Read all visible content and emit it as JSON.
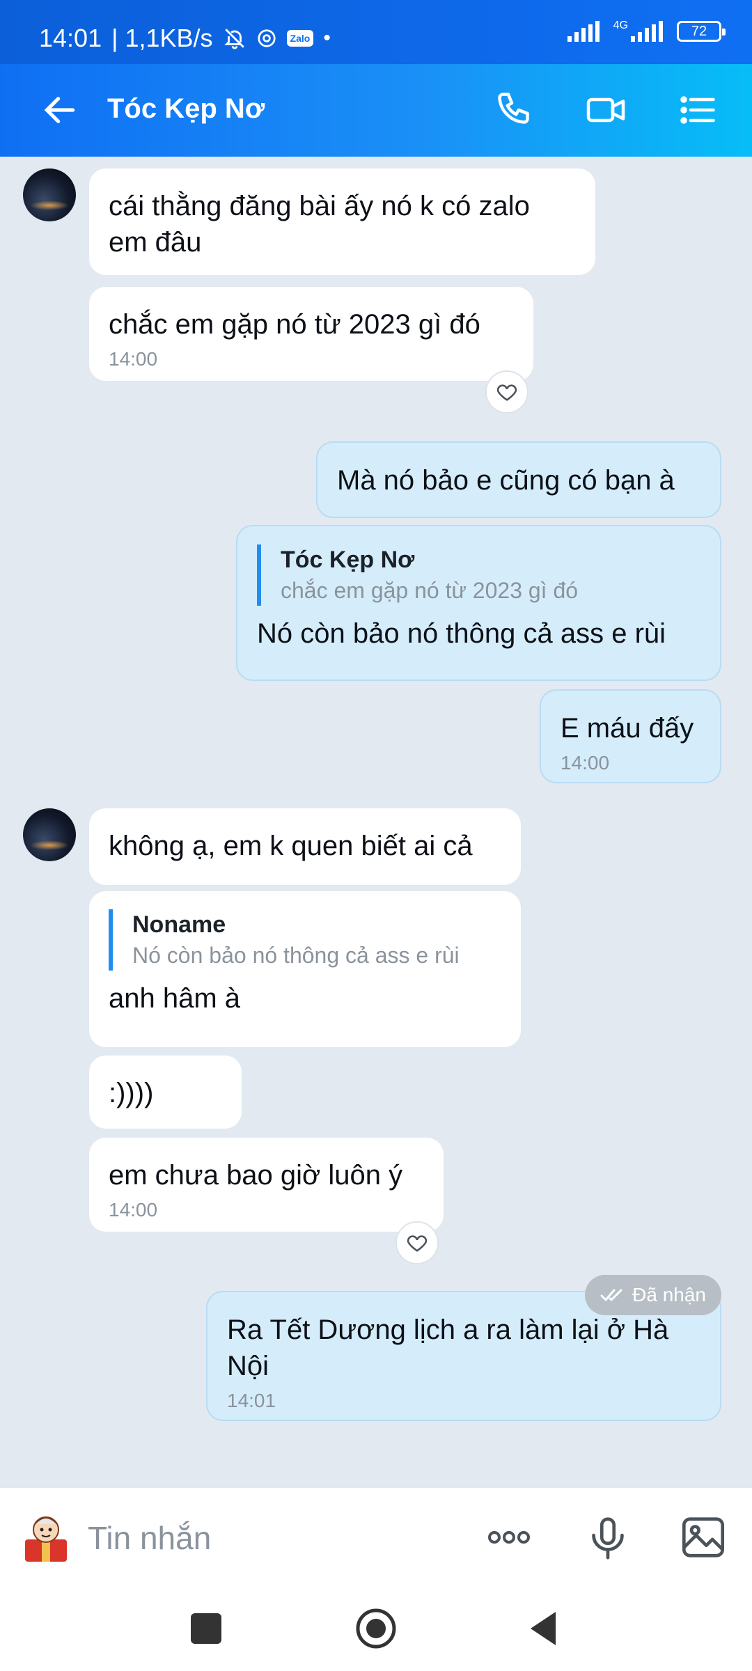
{
  "status_bar": {
    "time": "14:01",
    "speed": "| 1,1KB/s",
    "zalo_badge": "Zalo",
    "network": "4G",
    "battery": "72"
  },
  "header": {
    "title": "Tóc Kẹp Nơ"
  },
  "messages": {
    "m1": {
      "text": "cái thằng đăng bài ấy nó k có zalo em đâu"
    },
    "m2": {
      "text": "chắc em gặp nó từ 2023 gì đó",
      "time": "14:00"
    },
    "m3": {
      "text": "Mà nó bảo e cũng có bạn à"
    },
    "m4": {
      "quote_name": "Tóc Kẹp Nơ",
      "quote_text": "chắc em gặp nó từ 2023 gì đó",
      "text": "Nó còn bảo nó thông cả ass e rùi"
    },
    "m5": {
      "text": "E máu đấy",
      "time": "14:00"
    },
    "m6": {
      "text": "không ạ, em k quen biết ai cả"
    },
    "m7": {
      "quote_name": "Noname",
      "quote_text": "Nó còn bảo nó thông cả ass e rùi",
      "text": "anh hâm à"
    },
    "m8": {
      "text": ":))))"
    },
    "m9": {
      "text": "em chưa bao giờ luôn ý",
      "time": "14:00"
    },
    "m10": {
      "text": "Ra Tết Dương lịch a ra làm lại ở Hà Nội",
      "time": "14:01"
    }
  },
  "delivery_status": "Đã nhận",
  "input": {
    "placeholder": "Tin nhắn"
  },
  "icons": [
    "back-arrow-icon",
    "phone-icon",
    "video-call-icon",
    "menu-list-icon",
    "heart-icon",
    "double-check-icon",
    "sticker-icon",
    "more-icon",
    "microphone-icon",
    "image-icon",
    "nav-square-icon",
    "nav-home-icon",
    "nav-back-icon"
  ],
  "colors": {
    "header_start": "#0f6ff3",
    "header_end": "#07bdf7",
    "sent_bubble": "#d5edfb",
    "chat_bg": "#e2e9f1",
    "quote_bar": "#1f8ef1"
  }
}
